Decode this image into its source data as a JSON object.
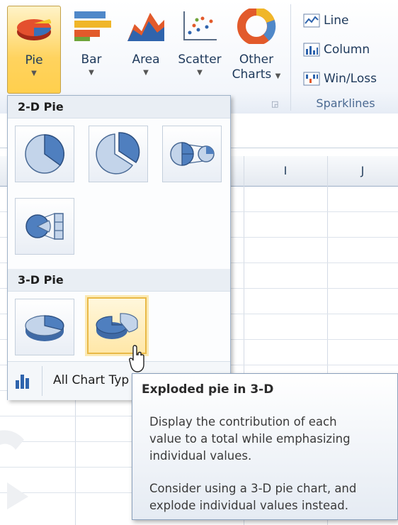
{
  "ribbon": {
    "chart_buttons": [
      {
        "label": "Pie",
        "icon": "pie-chart-icon"
      },
      {
        "label": "Bar",
        "icon": "bar-chart-icon"
      },
      {
        "label": "Area",
        "icon": "area-chart-icon"
      },
      {
        "label": "Scatter",
        "icon": "scatter-chart-icon"
      },
      {
        "label": "Other",
        "label2": "Charts",
        "icon": "doughnut-chart-icon"
      }
    ],
    "sparklines": {
      "items": [
        {
          "label": "Line",
          "icon": "sparkline-line-icon"
        },
        {
          "label": "Column",
          "icon": "sparkline-column-icon"
        },
        {
          "label": "Win/Loss",
          "icon": "sparkline-winloss-icon"
        }
      ],
      "group_label": "Sparklines"
    }
  },
  "sheet": {
    "columns": [
      "I",
      "J"
    ]
  },
  "pie_menu": {
    "section_2d": "2-D Pie",
    "section_3d": "3-D Pie",
    "thumbnails_2d": [
      "pie-icon",
      "exploded-pie-icon",
      "pie-of-pie-icon",
      "bar-of-pie-icon"
    ],
    "thumbnails_3d": [
      "pie-3d-icon",
      "exploded-pie-3d-icon"
    ],
    "selected": "exploded-pie-3d-icon",
    "footer_label": "All Chart Typ"
  },
  "tooltip": {
    "title": "Exploded pie in 3-D",
    "body_lines_1": [
      "Display the contribution of each",
      "value to a total while emphasizing",
      "individual values."
    ],
    "body_lines_2": [
      "Consider using a 3-D pie chart, and",
      "explode individual values instead."
    ]
  },
  "colors": {
    "accent_selected": "#ffd35e",
    "ribbon_text": "#1e395b",
    "pie_blue": "#4f7fbf"
  }
}
